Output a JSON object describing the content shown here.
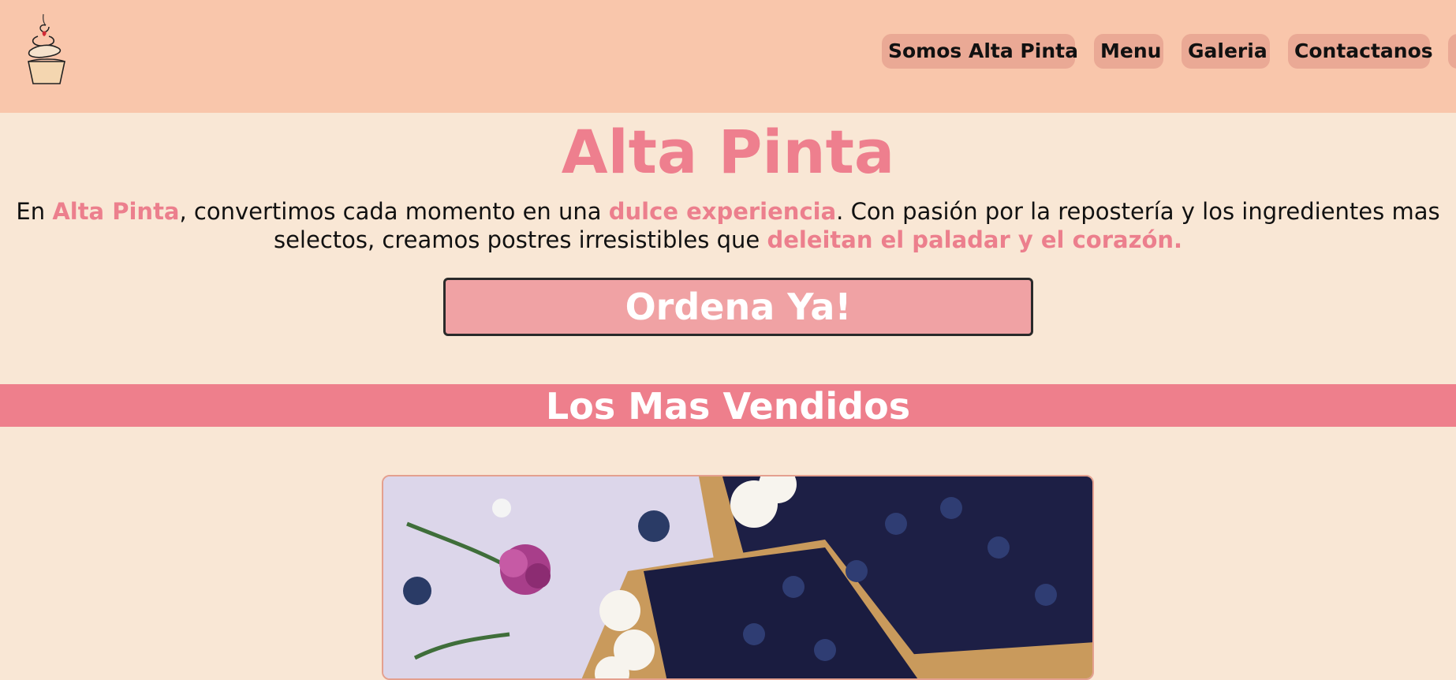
{
  "header": {
    "logo_icon": "cupcake-logo-icon",
    "nav": [
      {
        "label": "Somos Alta Pinta"
      },
      {
        "label": "Menu"
      },
      {
        "label": "Galeria"
      },
      {
        "label": "Contactanos"
      }
    ]
  },
  "hero": {
    "title": "Alta Pinta",
    "intro": {
      "p1": "En ",
      "h1": "Alta Pinta",
      "p2": ", convertimos cada momento en una ",
      "h2": "dulce experiencia",
      "p3": ". Con pasión por la repostería y los ingredientes mas",
      "p4": "selectos, creamos postres irresistibles que ",
      "h3": "deleitan el paladar y el corazón."
    },
    "order_label": "Ordena Ya!"
  },
  "best_sellers": {
    "title": "Los Mas Vendidos",
    "photo_icon": "blueberry-cheesecake-photo"
  },
  "colors": {
    "header_bg": "#f9c6ab",
    "page_bg": "#f9e7d5",
    "accent_pink": "#ee7f8e",
    "button_bg": "#f0a2a4",
    "nav_pill": "#eaa995"
  }
}
